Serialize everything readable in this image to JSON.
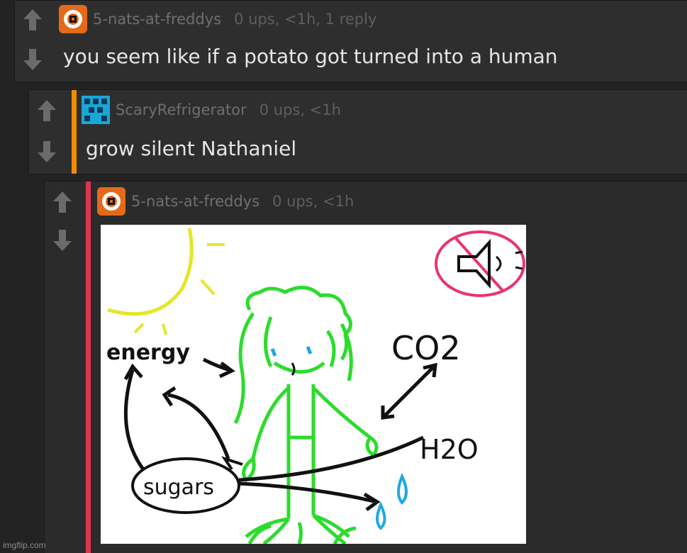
{
  "comments": [
    {
      "author": "5-nats-at-freddys",
      "meta": "0 ups, <1h, 1 reply",
      "text": "you seem like if a potato got turned into a human",
      "accent": "#e46a1a"
    },
    {
      "author": "ScaryRefrigerator",
      "meta": "0 ups, <1h",
      "text": "grow silent Nathaniel",
      "accent": "#f08c00"
    },
    {
      "author": "5-nats-at-freddys",
      "meta": "0 ups, <1h",
      "accent": "#e0344f",
      "drawing_labels": {
        "energy": "energy",
        "co2": "CO2",
        "h2o": "H2O",
        "sugars": "sugars"
      }
    }
  ],
  "icons": {
    "upvote": "up-arrow-icon",
    "downvote": "down-arrow-icon"
  },
  "colors": {
    "page_bg": "#232323",
    "comment_bg": "#2e2e2e",
    "author": "#6f6f6f",
    "meta": "#5f5f5f",
    "body": "#e6e6e6",
    "vote_icon": "#6b6b6b"
  },
  "watermark": "imgflip.com"
}
